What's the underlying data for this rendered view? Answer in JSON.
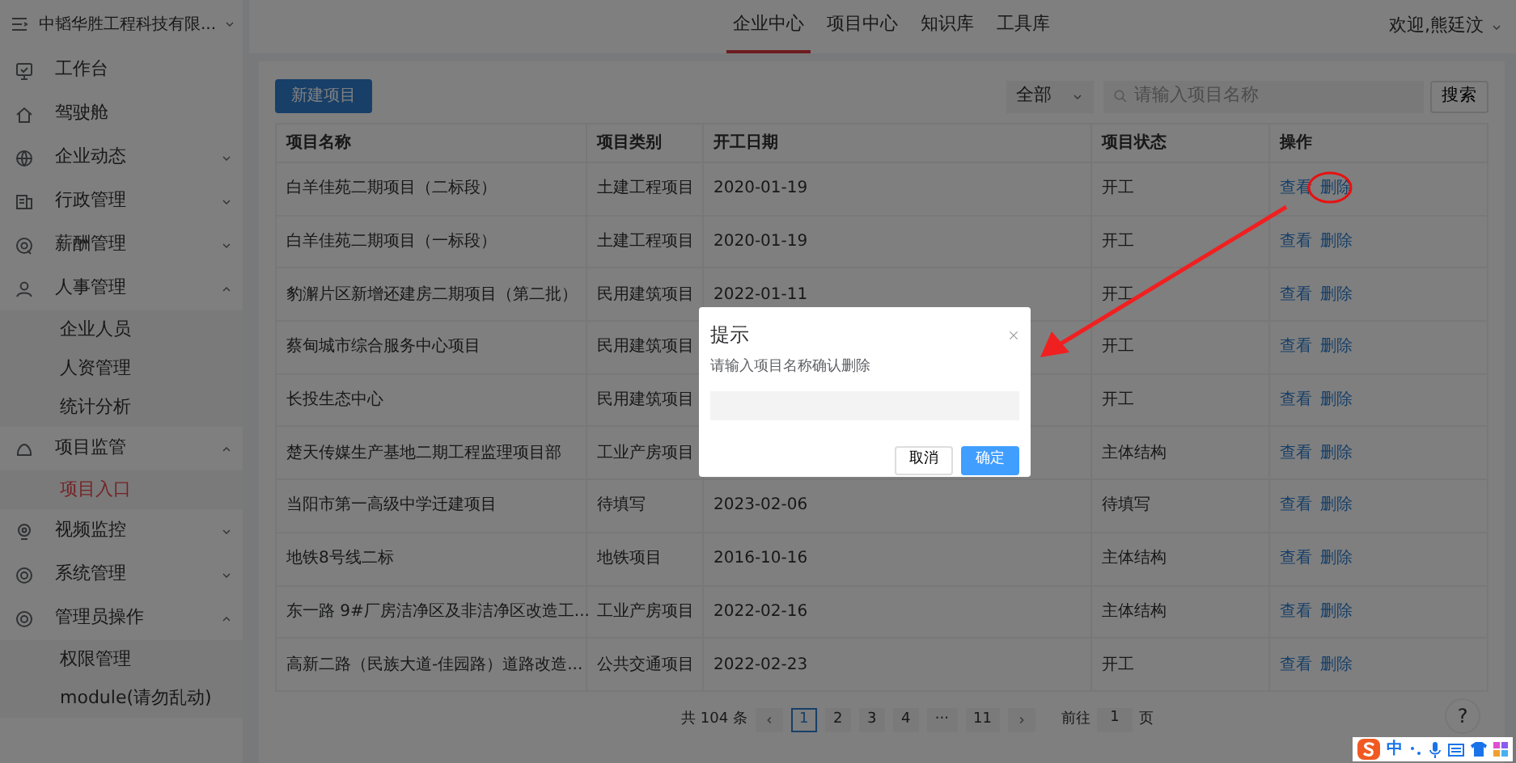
{
  "sidebar": {
    "title": "中韬华胜工程科技有限...",
    "items": [
      {
        "label": "工作台",
        "selected": false
      },
      {
        "label": "驾驶舱",
        "selected": false
      },
      {
        "label": "企业动态",
        "selected": false,
        "expanded": false
      },
      {
        "label": "行政管理",
        "selected": false,
        "expanded": false
      },
      {
        "label": "薪酬管理",
        "selected": false,
        "expanded": false
      },
      {
        "label": "人事管理",
        "selected": false,
        "expanded": true,
        "children": [
          {
            "label": "企业人员",
            "selected": false
          },
          {
            "label": "人资管理",
            "selected": false
          },
          {
            "label": "统计分析",
            "selected": false
          }
        ]
      },
      {
        "label": "项目监管",
        "selected": false,
        "expanded": true,
        "children": [
          {
            "label": "项目入口",
            "selected": true
          }
        ]
      },
      {
        "label": "视频监控",
        "selected": false,
        "expanded": false
      },
      {
        "label": "系统管理",
        "selected": false,
        "expanded": false
      },
      {
        "label": "管理员操作",
        "selected": false,
        "expanded": true,
        "children": [
          {
            "label": "权限管理",
            "selected": false
          },
          {
            "label": "module(请勿乱动)",
            "selected": false
          }
        ]
      }
    ]
  },
  "top_tabs": [
    {
      "label": "企业中心",
      "selected": true
    },
    {
      "label": "项目中心",
      "selected": false
    },
    {
      "label": "知识库",
      "selected": false
    },
    {
      "label": "工具库",
      "selected": false
    }
  ],
  "user_menu": "欢迎,熊廷汶",
  "new_button": "新建项目",
  "filter": {
    "value": "全部",
    "placeholder": "请输入项目名称",
    "button": "搜索"
  },
  "table": {
    "columns": [
      "项目名称",
      "项目类别",
      "开工日期",
      "项目状态",
      "操作"
    ],
    "rows": [
      {
        "name": "白羊佳苑二期项目（二标段）",
        "category": "土建工程项目",
        "start_date": "2020-01-19",
        "status": "开工",
        "actions": [
          "查看",
          "删除"
        ]
      },
      {
        "name": "白羊佳苑二期项目（一标段）",
        "category": "土建工程项目",
        "start_date": "2020-01-19",
        "status": "开工",
        "actions": [
          "查看",
          "删除"
        ]
      },
      {
        "name": "豹澥片区新增还建房二期项目（第二批）",
        "category": "民用建筑项目",
        "start_date": "2022-01-11",
        "status": "开工",
        "actions": [
          "查看",
          "删除"
        ]
      },
      {
        "name": "蔡甸城市综合服务中心项目",
        "category": "民用建筑项目",
        "status": "开工",
        "actions": [
          "查看",
          "删除"
        ]
      },
      {
        "name": "长投生态中心",
        "category": "民用建筑项目",
        "status": "开工",
        "actions": [
          "查看",
          "删除"
        ]
      },
      {
        "name": "楚天传媒生产基地二期工程监理项目部",
        "category": "工业产房项目",
        "status": "主体结构",
        "actions": [
          "查看",
          "删除"
        ]
      },
      {
        "name": "当阳市第一高级中学迁建项目",
        "category": "待填写",
        "start_date": "2023-02-06",
        "status": "待填写",
        "actions": [
          "查看",
          "删除"
        ]
      },
      {
        "name": "地铁8号线二标",
        "category": "地铁项目",
        "start_date": "2016-10-16",
        "status": "主体结构",
        "actions": [
          "查看",
          "删除"
        ]
      },
      {
        "name": "东一路 9#厂房洁净区及非洁净区改造工...",
        "category": "工业产房项目",
        "start_date": "2022-02-16",
        "status": "主体结构",
        "actions": [
          "查看",
          "删除"
        ]
      },
      {
        "name": "高新二路（民族大道-佳园路）道路改造...",
        "category": "公共交通项目",
        "start_date": "2022-02-23",
        "status": "开工",
        "actions": [
          "查看",
          "删除"
        ]
      }
    ]
  },
  "pagination": {
    "total": "共 104 条",
    "pages": [
      {
        "label": "1",
        "selected": true
      },
      {
        "label": "2",
        "selected": false
      },
      {
        "label": "3",
        "selected": false
      },
      {
        "label": "4",
        "selected": false
      },
      {
        "label": "···",
        "selected": false
      },
      {
        "label": "11",
        "selected": false
      }
    ],
    "jump_prefix": "前往",
    "jump_value": "1",
    "jump_suffix": "页"
  },
  "help_button": "?",
  "dialog": {
    "title": "提示",
    "message": "请输入项目名称确认删除",
    "buttons": [
      {
        "label": "取消",
        "kind": "default"
      },
      {
        "label": "确定",
        "kind": "primary"
      }
    ]
  },
  "ime_toolbar": {
    "mode": "中"
  }
}
